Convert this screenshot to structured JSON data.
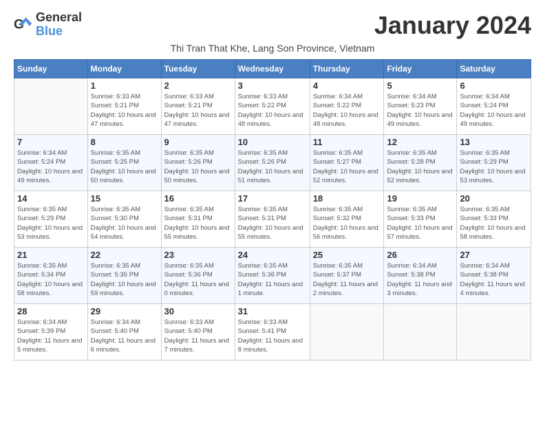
{
  "logo": {
    "general": "General",
    "blue": "Blue"
  },
  "title": "January 2024",
  "subtitle": "Thi Tran That Khe, Lang Son Province, Vietnam",
  "header_days": [
    "Sunday",
    "Monday",
    "Tuesday",
    "Wednesday",
    "Thursday",
    "Friday",
    "Saturday"
  ],
  "weeks": [
    [
      {
        "day": "",
        "info": ""
      },
      {
        "day": "1",
        "info": "Sunrise: 6:33 AM\nSunset: 5:21 PM\nDaylight: 10 hours\nand 47 minutes."
      },
      {
        "day": "2",
        "info": "Sunrise: 6:33 AM\nSunset: 5:21 PM\nDaylight: 10 hours\nand 47 minutes."
      },
      {
        "day": "3",
        "info": "Sunrise: 6:33 AM\nSunset: 5:22 PM\nDaylight: 10 hours\nand 48 minutes."
      },
      {
        "day": "4",
        "info": "Sunrise: 6:34 AM\nSunset: 5:22 PM\nDaylight: 10 hours\nand 48 minutes."
      },
      {
        "day": "5",
        "info": "Sunrise: 6:34 AM\nSunset: 5:23 PM\nDaylight: 10 hours\nand 49 minutes."
      },
      {
        "day": "6",
        "info": "Sunrise: 6:34 AM\nSunset: 5:24 PM\nDaylight: 10 hours\nand 49 minutes."
      }
    ],
    [
      {
        "day": "7",
        "info": "Sunrise: 6:34 AM\nSunset: 5:24 PM\nDaylight: 10 hours\nand 49 minutes."
      },
      {
        "day": "8",
        "info": "Sunrise: 6:35 AM\nSunset: 5:25 PM\nDaylight: 10 hours\nand 50 minutes."
      },
      {
        "day": "9",
        "info": "Sunrise: 6:35 AM\nSunset: 5:26 PM\nDaylight: 10 hours\nand 50 minutes."
      },
      {
        "day": "10",
        "info": "Sunrise: 6:35 AM\nSunset: 5:26 PM\nDaylight: 10 hours\nand 51 minutes."
      },
      {
        "day": "11",
        "info": "Sunrise: 6:35 AM\nSunset: 5:27 PM\nDaylight: 10 hours\nand 52 minutes."
      },
      {
        "day": "12",
        "info": "Sunrise: 6:35 AM\nSunset: 5:28 PM\nDaylight: 10 hours\nand 52 minutes."
      },
      {
        "day": "13",
        "info": "Sunrise: 6:35 AM\nSunset: 5:29 PM\nDaylight: 10 hours\nand 53 minutes."
      }
    ],
    [
      {
        "day": "14",
        "info": "Sunrise: 6:35 AM\nSunset: 5:29 PM\nDaylight: 10 hours\nand 53 minutes."
      },
      {
        "day": "15",
        "info": "Sunrise: 6:35 AM\nSunset: 5:30 PM\nDaylight: 10 hours\nand 54 minutes."
      },
      {
        "day": "16",
        "info": "Sunrise: 6:35 AM\nSunset: 5:31 PM\nDaylight: 10 hours\nand 55 minutes."
      },
      {
        "day": "17",
        "info": "Sunrise: 6:35 AM\nSunset: 5:31 PM\nDaylight: 10 hours\nand 55 minutes."
      },
      {
        "day": "18",
        "info": "Sunrise: 6:35 AM\nSunset: 5:32 PM\nDaylight: 10 hours\nand 56 minutes."
      },
      {
        "day": "19",
        "info": "Sunrise: 6:35 AM\nSunset: 5:33 PM\nDaylight: 10 hours\nand 57 minutes."
      },
      {
        "day": "20",
        "info": "Sunrise: 6:35 AM\nSunset: 5:33 PM\nDaylight: 10 hours\nand 58 minutes."
      }
    ],
    [
      {
        "day": "21",
        "info": "Sunrise: 6:35 AM\nSunset: 5:34 PM\nDaylight: 10 hours\nand 58 minutes."
      },
      {
        "day": "22",
        "info": "Sunrise: 6:35 AM\nSunset: 5:35 PM\nDaylight: 10 hours\nand 59 minutes."
      },
      {
        "day": "23",
        "info": "Sunrise: 6:35 AM\nSunset: 5:36 PM\nDaylight: 11 hours\nand 0 minutes."
      },
      {
        "day": "24",
        "info": "Sunrise: 6:35 AM\nSunset: 5:36 PM\nDaylight: 11 hours\nand 1 minute."
      },
      {
        "day": "25",
        "info": "Sunrise: 6:35 AM\nSunset: 5:37 PM\nDaylight: 11 hours\nand 2 minutes."
      },
      {
        "day": "26",
        "info": "Sunrise: 6:34 AM\nSunset: 5:38 PM\nDaylight: 11 hours\nand 3 minutes."
      },
      {
        "day": "27",
        "info": "Sunrise: 6:34 AM\nSunset: 5:38 PM\nDaylight: 11 hours\nand 4 minutes."
      }
    ],
    [
      {
        "day": "28",
        "info": "Sunrise: 6:34 AM\nSunset: 5:39 PM\nDaylight: 11 hours\nand 5 minutes."
      },
      {
        "day": "29",
        "info": "Sunrise: 6:34 AM\nSunset: 5:40 PM\nDaylight: 11 hours\nand 6 minutes."
      },
      {
        "day": "30",
        "info": "Sunrise: 6:33 AM\nSunset: 5:40 PM\nDaylight: 11 hours\nand 7 minutes."
      },
      {
        "day": "31",
        "info": "Sunrise: 6:33 AM\nSunset: 5:41 PM\nDaylight: 11 hours\nand 8 minutes."
      },
      {
        "day": "",
        "info": ""
      },
      {
        "day": "",
        "info": ""
      },
      {
        "day": "",
        "info": ""
      }
    ]
  ],
  "colors": {
    "header_bg": "#4a7fc1",
    "header_text": "#ffffff",
    "accent": "#4a90d9"
  }
}
